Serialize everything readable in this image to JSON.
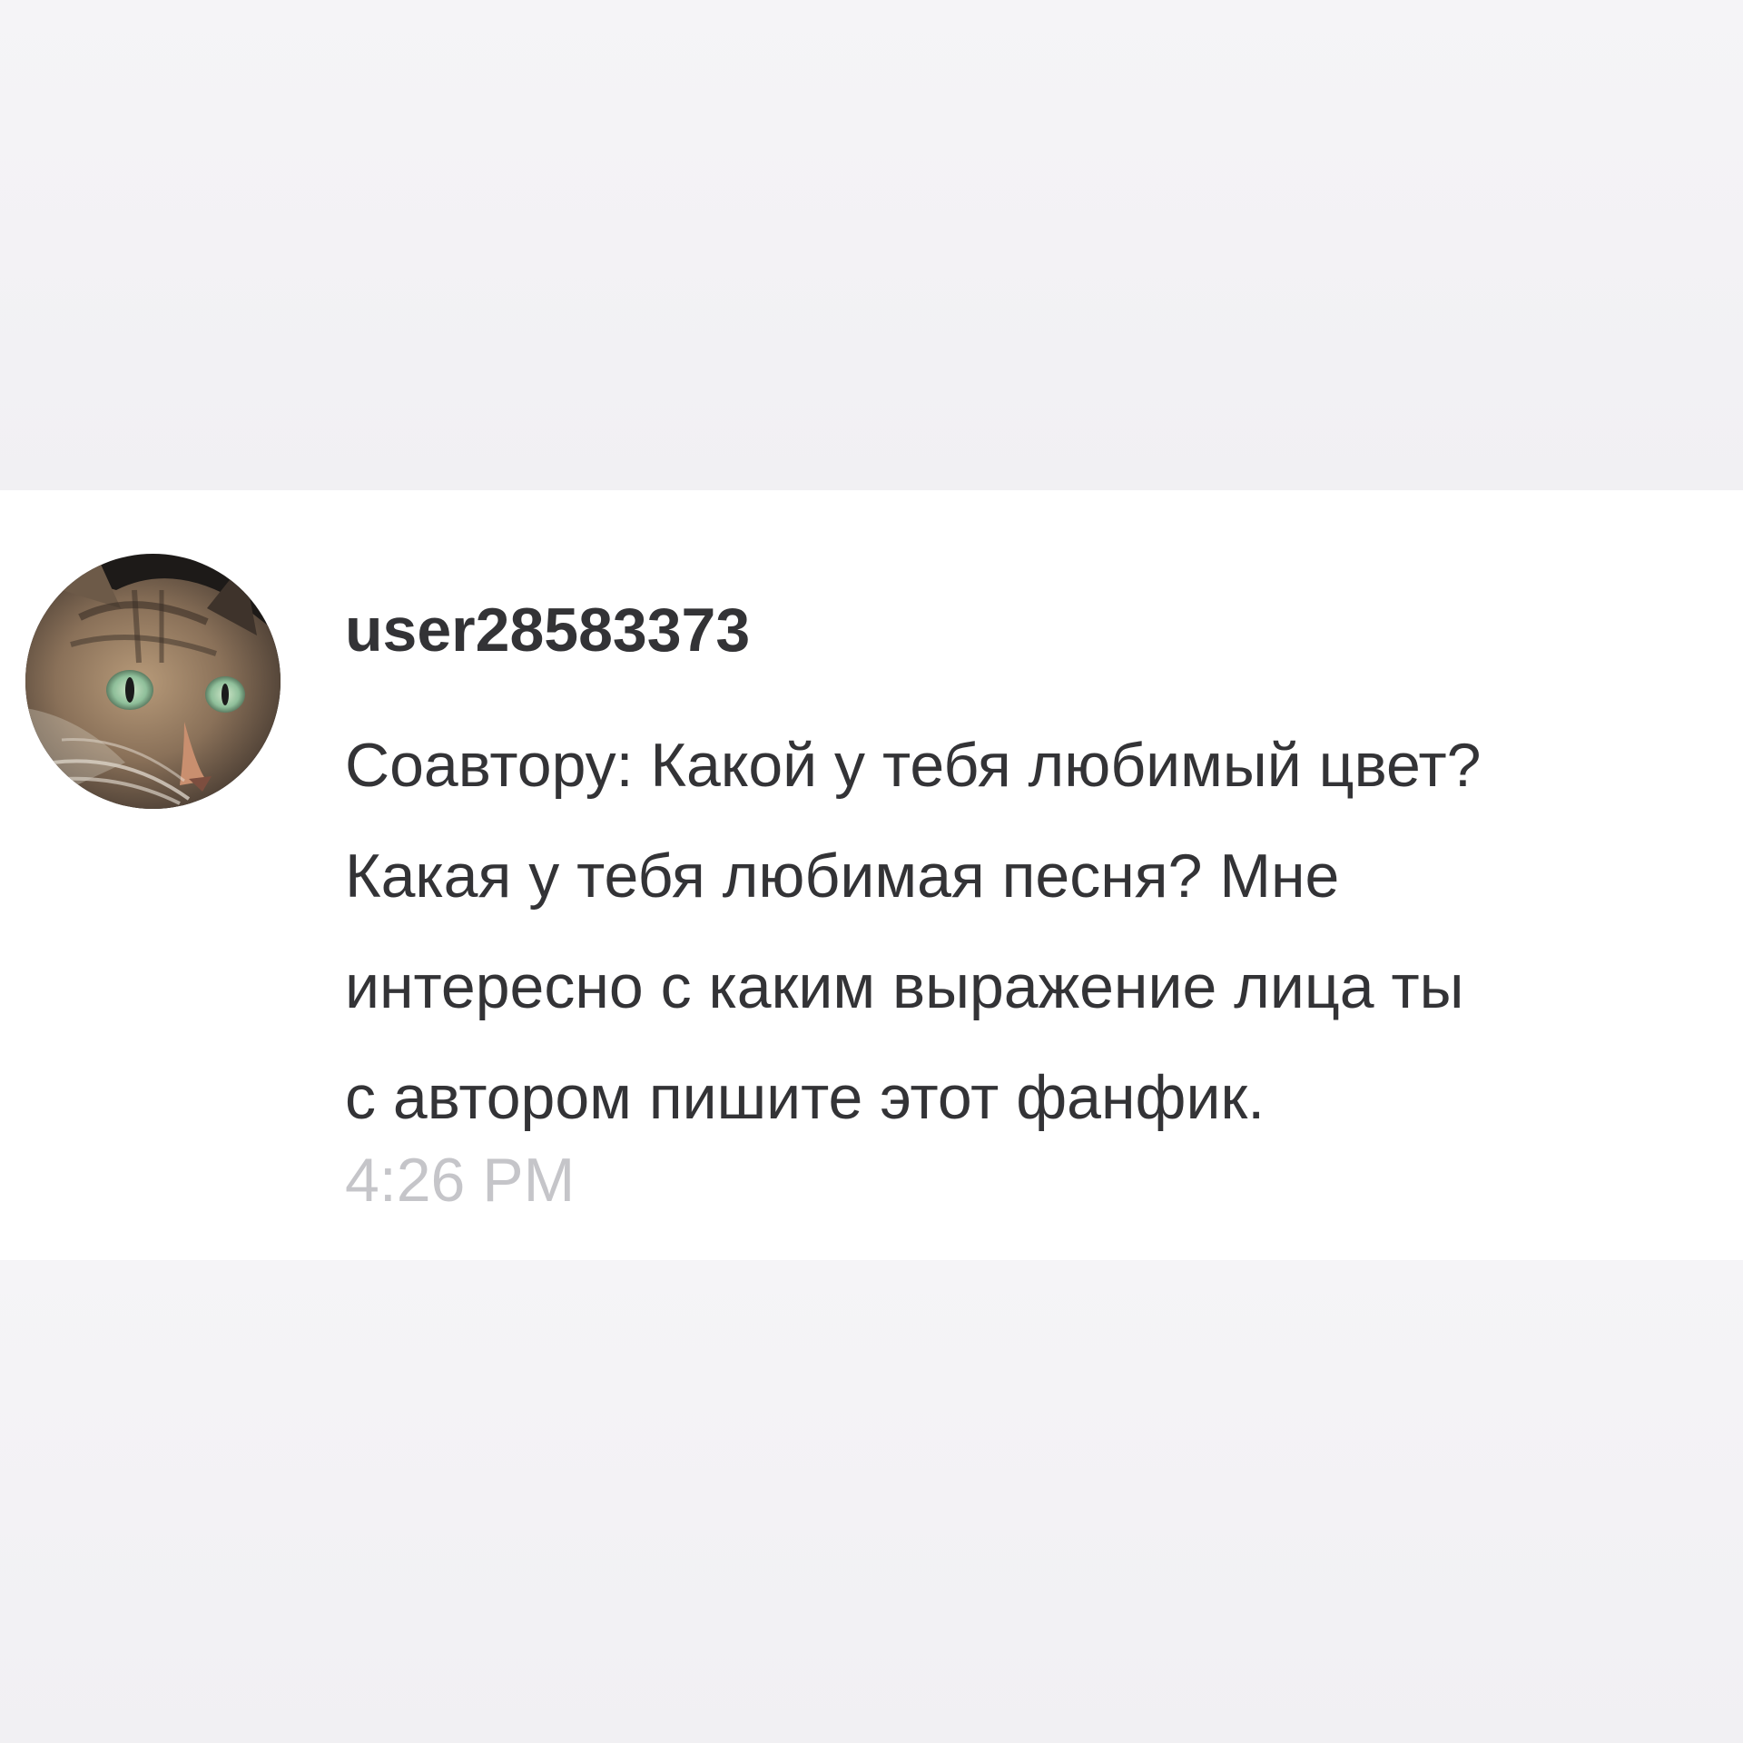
{
  "comment": {
    "username": "user28583373",
    "message_lines": [
      "Соавтору: Какой у тебя любимый цвет?",
      "Какая у тебя любимая песня? Мне",
      "интересно с каким выражение лица ты",
      "с автором пишите этот фанфик."
    ],
    "timestamp": "4:26 PM",
    "avatar_icon": "cat-avatar"
  },
  "colors": {
    "background": "#f3f2f5",
    "card": "#ffffff",
    "text": "#333336",
    "timestamp": "#c5c5c9"
  }
}
